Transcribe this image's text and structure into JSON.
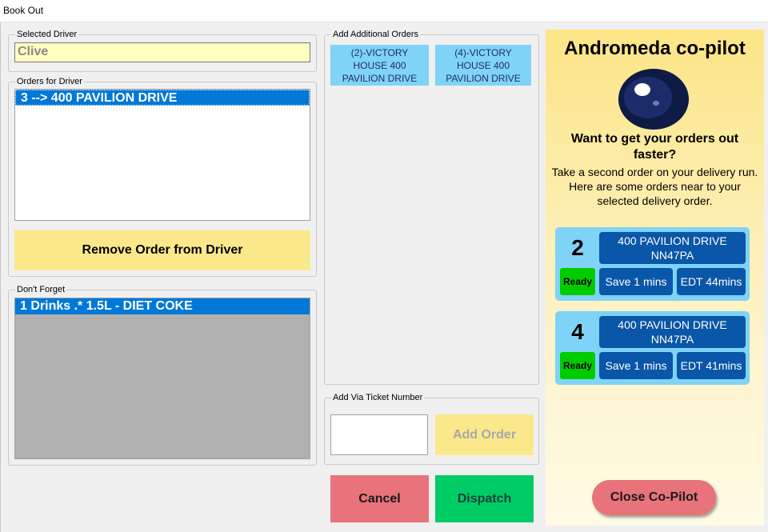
{
  "window": {
    "title": "Book Out"
  },
  "selected_driver": {
    "legend": "Selected Driver",
    "value": "Clive"
  },
  "orders_for_driver": {
    "legend": "Orders for Driver",
    "items": [
      "3 --> 400  PAVILION DRIVE"
    ],
    "remove_button": "Remove Order from Driver"
  },
  "dont_forget": {
    "legend": "Don't Forget",
    "items": [
      "1 Drinks .* 1.5L - DIET COKE"
    ]
  },
  "additional_orders": {
    "legend": "Add Additional Orders",
    "tiles": [
      {
        "line1": "(2)-VICTORY",
        "line2": "HOUSE 400",
        "line3": "PAVILION DRIVE"
      },
      {
        "line1": "(4)-VICTORY",
        "line2": "HOUSE 400",
        "line3": "PAVILION DRIVE"
      }
    ]
  },
  "ticket": {
    "legend": "Add Via Ticket Number",
    "input_value": "",
    "add_button": "Add Order"
  },
  "actions": {
    "cancel": "Cancel",
    "dispatch": "Dispatch"
  },
  "copilot": {
    "title": "Andromeda co-pilot",
    "heading": "Want to get your orders out faster?",
    "body": "Take a second order on your delivery run. Here are some orders near to your selected delivery order.",
    "cards": [
      {
        "number": "2",
        "address": "400 PAVILION DRIVE",
        "postcode": "NN47PA",
        "status": "Ready",
        "save": "Save 1 mins",
        "edt": "EDT 44mins"
      },
      {
        "number": "4",
        "address": "400 PAVILION DRIVE",
        "postcode": "NN47PA",
        "status": "Ready",
        "save": "Save 1 mins",
        "edt": "EDT 41mins"
      }
    ],
    "close_button": "Close Co-Pilot",
    "icon": "astronaut-helmet-icon"
  },
  "colors": {
    "tile_blue": "#7fd3f7",
    "dark_blue": "#0a56a8",
    "ready_green": "#00cc00",
    "dispatch_green": "#00cc66",
    "cancel_red": "#e9737a",
    "yellow": "#fbe88a",
    "selection_blue": "#0078d7"
  }
}
